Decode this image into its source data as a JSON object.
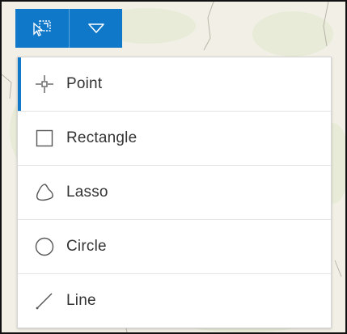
{
  "toolbar": {
    "select_tool_icon": "select-by-shape-icon",
    "dropdown_icon": "caret-down-icon"
  },
  "menu": {
    "items": [
      {
        "label": "Point",
        "icon": "point-crosshair-icon",
        "active": true
      },
      {
        "label": "Rectangle",
        "icon": "rectangle-icon",
        "active": false
      },
      {
        "label": "Lasso",
        "icon": "lasso-icon",
        "active": false
      },
      {
        "label": "Circle",
        "icon": "circle-icon",
        "active": false
      },
      {
        "label": "Line",
        "icon": "line-icon",
        "active": false
      }
    ]
  },
  "colors": {
    "accent": "#0f78c9",
    "text": "#333333",
    "divider": "#e4e4e4"
  }
}
